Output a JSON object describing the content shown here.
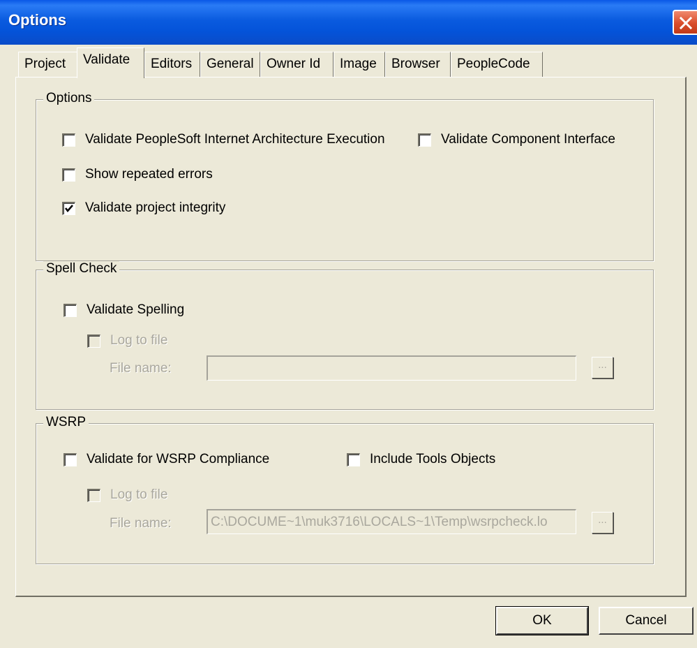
{
  "window": {
    "title": "Options"
  },
  "tabs": [
    {
      "label": "Project"
    },
    {
      "label": "Validate",
      "active": true
    },
    {
      "label": "Editors"
    },
    {
      "label": "General"
    },
    {
      "label": "Owner Id"
    },
    {
      "label": "Image"
    },
    {
      "label": "Browser"
    },
    {
      "label": "PeopleCode"
    }
  ],
  "options_group": {
    "label": "Options",
    "validate_pia": {
      "label": "Validate PeopleSoft Internet Architecture Execution",
      "checked": false
    },
    "validate_ci": {
      "label": "Validate Component Interface",
      "checked": false
    },
    "show_repeated": {
      "label": "Show repeated errors",
      "checked": false
    },
    "validate_integrity": {
      "label": "Validate project integrity",
      "checked": true
    }
  },
  "spell_group": {
    "label": "Spell Check",
    "validate_spelling": {
      "label": "Validate Spelling",
      "checked": false
    },
    "log_to_file": {
      "label": "Log to file",
      "checked": false,
      "disabled": true
    },
    "file_name_label": "File name:",
    "file_name_value": "",
    "browse_label": "..."
  },
  "wsrp_group": {
    "label": "WSRP",
    "validate_wsrp": {
      "label": "Validate for WSRP Compliance",
      "checked": false
    },
    "include_tools": {
      "label": "Include Tools Objects",
      "checked": false
    },
    "log_to_file": {
      "label": "Log to file",
      "checked": false,
      "disabled": true
    },
    "file_name_label": "File name:",
    "file_name_value": "C:\\DOCUME~1\\muk3716\\LOCALS~1\\Temp\\wsrpcheck.lo",
    "browse_label": "..."
  },
  "buttons": {
    "ok": "OK",
    "cancel": "Cancel"
  },
  "colors": {
    "titlebar": "#0A5BDF",
    "face": "#ECE9D8",
    "disabled_text": "#A9A79D",
    "close": "#D94C2A"
  }
}
